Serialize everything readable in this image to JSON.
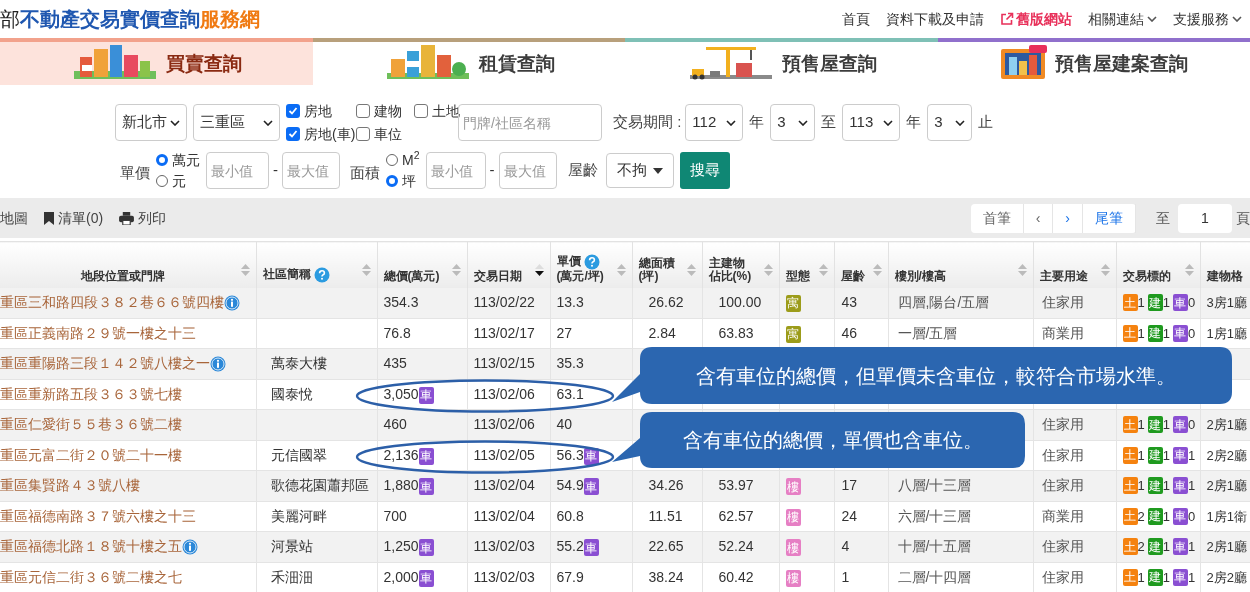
{
  "header": {
    "logo_prefix": "部",
    "logo_main": "不動產交易實價查詢",
    "logo_accent": "服務網",
    "nav": [
      {
        "label": "首頁",
        "kind": "link"
      },
      {
        "label": "資料下載及申請",
        "kind": "link"
      },
      {
        "label": "舊版網站",
        "kind": "external"
      },
      {
        "label": "相關連結",
        "kind": "menu"
      },
      {
        "label": "支援服務",
        "kind": "menu"
      }
    ]
  },
  "tabs": [
    {
      "label": "買賣查詢",
      "selected": true,
      "color": "#f2a28c"
    },
    {
      "label": "租賃查詢",
      "selected": false,
      "color": "#b8a07c"
    },
    {
      "label": "預售屋查詢",
      "selected": false,
      "color": "#7fc0b6"
    },
    {
      "label": "預售屋建案查詢",
      "selected": false,
      "color": "#9070cc"
    }
  ],
  "filters": {
    "city": "新北市",
    "district": "三重區",
    "checkboxes": [
      {
        "label": "房地",
        "checked": true
      },
      {
        "label": "房地(車)",
        "checked": true
      },
      {
        "label": "建物",
        "checked": false
      },
      {
        "label": "車位",
        "checked": false
      },
      {
        "label": "土地",
        "checked": false
      }
    ],
    "address_placeholder": "門牌/社區名稱",
    "period": {
      "label": "交易期間 :",
      "from_year": "112",
      "from_year_unit": "年",
      "from_month": "3",
      "to": "至",
      "to_year": "113",
      "to_year_unit": "年",
      "to_month": "3",
      "end": "止"
    },
    "price": {
      "label": "單價",
      "options": [
        {
          "label": "萬元",
          "selected": true
        },
        {
          "label": "元",
          "selected": false
        }
      ],
      "min_placeholder": "最小值",
      "dash": "-",
      "max_placeholder": "最大值"
    },
    "area": {
      "label": "面積",
      "options": [
        {
          "label": "M$^{2}$",
          "selected": false
        },
        {
          "label": "坪",
          "selected": true
        }
      ],
      "min_placeholder": "最小值",
      "dash": "-",
      "max_placeholder": "最大值"
    },
    "age": {
      "label": "屋齡",
      "value": "不拘"
    },
    "search_button": "搜尋"
  },
  "toolbar": {
    "items": [
      {
        "label": "地圖",
        "kind": "map"
      },
      {
        "label": "清單(0)",
        "kind": "list"
      },
      {
        "label": "列印",
        "kind": "print"
      }
    ],
    "pager": [
      {
        "label": "首筆",
        "disabled": true
      },
      {
        "label": "‹",
        "disabled": true
      },
      {
        "label": "›",
        "disabled": false
      },
      {
        "label": "尾筆",
        "disabled": false
      }
    ],
    "goto": "至",
    "page": "1",
    "page_unit": "頁"
  },
  "table": {
    "columns": [
      {
        "label": "地段位置或門牌",
        "help": false,
        "sortable": true,
        "sorted": false
      },
      {
        "label": "社區簡稱",
        "help": true,
        "sortable": true,
        "sorted": false
      },
      {
        "label": "總價(萬元)",
        "help": false,
        "sortable": true,
        "sorted": false
      },
      {
        "label": "交易日期",
        "help": false,
        "sortable": true,
        "sorted": true
      },
      {
        "label": "單價",
        "sub": "(萬元/坪)",
        "help": true,
        "sortable": true,
        "sorted": false
      },
      {
        "label": "總面積",
        "sub": "(坪)",
        "help": false,
        "sortable": true,
        "sorted": false
      },
      {
        "label": "主建物",
        "sub": "佔比(%)",
        "help": false,
        "sortable": true,
        "sorted": false
      },
      {
        "label": "型態",
        "help": false,
        "sortable": true,
        "sorted": false
      },
      {
        "label": "屋齡",
        "help": false,
        "sortable": true,
        "sorted": false
      },
      {
        "label": "樓別/樓高",
        "help": false,
        "sortable": true,
        "sorted": false
      },
      {
        "label": "主要用途",
        "help": false,
        "sortable": true,
        "sorted": false
      },
      {
        "label": "交易標的",
        "help": false,
        "sortable": true,
        "sorted": false
      },
      {
        "label": "建物格",
        "help": false,
        "sortable": false
      }
    ],
    "rows": [
      {
        "address": "重區三和路四段３８２巷６６號四樓",
        "info": true,
        "total": "354.3",
        "date": "113/02/22",
        "unit": "13.3",
        "area": "26.62",
        "ratio": "100.00",
        "type": {
          "label": "寓",
          "color": "#9c9c1a"
        },
        "age": "43",
        "floor": "四層,陽台/五層",
        "use": "住家用",
        "targets": [
          {
            "label": "土",
            "count": "1",
            "color": "#f5820f"
          },
          {
            "label": "建",
            "count": "1",
            "color": "#1f9a1f"
          },
          {
            "label": "車",
            "count": "0",
            "color": "#8a4fd2"
          }
        ],
        "layout": "3房1廳"
      },
      {
        "address": "重區正義南路２９號一樓之十三",
        "info": false,
        "total": "76.8",
        "date": "113/02/17",
        "unit": "27",
        "area": "2.84",
        "ratio": "63.83",
        "type": {
          "label": "寓",
          "color": "#9c9c1a"
        },
        "age": "46",
        "floor": "一層/五層",
        "use": "商業用",
        "targets": [
          {
            "label": "土",
            "count": "1",
            "color": "#f5820f"
          },
          {
            "label": "建",
            "count": "1",
            "color": "#1f9a1f"
          },
          {
            "label": "車",
            "count": "0",
            "color": "#8a4fd2"
          }
        ],
        "layout": "1房1廳"
      },
      {
        "address": "重區重陽路三段１４２號八樓之一",
        "info": true,
        "community": "萬泰大樓",
        "total": "435",
        "date": "113/02/15",
        "unit": "35.3"
      },
      {
        "address": "重區重新路五段３６３號七樓",
        "info": false,
        "community": "國泰悅",
        "total": "3,050",
        "total_badge": "車",
        "date": "113/02/06",
        "unit": "63.1"
      },
      {
        "address": "重區仁愛街５５巷３６號二樓",
        "info": false,
        "total": "460",
        "date": "113/02/06",
        "unit": "40",
        "use": "住家用",
        "targets": [
          {
            "label": "土",
            "count": "1",
            "color": "#f5820f"
          },
          {
            "label": "建",
            "count": "1",
            "color": "#1f9a1f"
          },
          {
            "label": "車",
            "count": "0",
            "color": "#8a4fd2"
          }
        ],
        "layout": "2房1廳"
      },
      {
        "address": "重區元富二街２０號二十一樓",
        "info": false,
        "community": "元信國翠",
        "total": "2,136",
        "total_badge": "車",
        "date": "113/02/05",
        "unit": "56.3",
        "unit_badge": "車",
        "use": "住家用",
        "targets": [
          {
            "label": "土",
            "count": "1",
            "color": "#f5820f"
          },
          {
            "label": "建",
            "count": "1",
            "color": "#1f9a1f"
          },
          {
            "label": "車",
            "count": "1",
            "color": "#8a4fd2"
          }
        ],
        "layout": "2房2廳"
      },
      {
        "address": "重區集賢路４３號八樓",
        "info": false,
        "community": "歌德花園蕭邦區",
        "total": "1,880",
        "total_badge": "車",
        "date": "113/02/04",
        "unit": "54.9",
        "unit_badge": "車",
        "area": "34.26",
        "ratio": "53.97",
        "type": {
          "label": "樓",
          "color": "#e67fc4"
        },
        "age": "17",
        "floor": "八層/十三層",
        "use": "住家用",
        "targets": [
          {
            "label": "土",
            "count": "1",
            "color": "#f5820f"
          },
          {
            "label": "建",
            "count": "1",
            "color": "#1f9a1f"
          },
          {
            "label": "車",
            "count": "1",
            "color": "#8a4fd2"
          }
        ],
        "layout": "2房1廳"
      },
      {
        "address": "重區福德南路３７號六樓之十三",
        "info": false,
        "community": "美麗河畔",
        "total": "700",
        "date": "113/02/04",
        "unit": "60.8",
        "area": "11.51",
        "ratio": "62.57",
        "type": {
          "label": "樓",
          "color": "#e67fc4"
        },
        "age": "24",
        "floor": "六層/十三層",
        "use": "商業用",
        "targets": [
          {
            "label": "土",
            "count": "2",
            "color": "#f5820f"
          },
          {
            "label": "建",
            "count": "1",
            "color": "#1f9a1f"
          },
          {
            "label": "車",
            "count": "0",
            "color": "#8a4fd2"
          }
        ],
        "layout": "1房1衛"
      },
      {
        "address": "重區福德北路１８號十樓之五",
        "info": true,
        "community": "河景站",
        "total": "1,250",
        "total_badge": "車",
        "date": "113/02/03",
        "unit": "55.2",
        "unit_badge": "車",
        "area": "22.65",
        "ratio": "52.24",
        "type": {
          "label": "樓",
          "color": "#e67fc4"
        },
        "age": "4",
        "floor": "十層/十五層",
        "use": "住家用",
        "targets": [
          {
            "label": "土",
            "count": "2",
            "color": "#f5820f"
          },
          {
            "label": "建",
            "count": "1",
            "color": "#1f9a1f"
          },
          {
            "label": "車",
            "count": "1",
            "color": "#8a4fd2"
          }
        ],
        "layout": "2房1廳"
      },
      {
        "address": "重區元信二街３６號二樓之七",
        "info": false,
        "community": "禾沺沺",
        "total": "2,000",
        "total_badge": "車",
        "date": "113/02/03",
        "unit": "67.9",
        "area": "38.24",
        "ratio": "60.42",
        "type": {
          "label": "樓",
          "color": "#e67fc4"
        },
        "age": "1",
        "floor": "二層/十四層",
        "use": "住家用",
        "targets": [
          {
            "label": "土",
            "count": "1",
            "color": "#f5820f"
          },
          {
            "label": "建",
            "count": "1",
            "color": "#1f9a1f"
          },
          {
            "label": "車",
            "count": "1",
            "color": "#8a4fd2"
          }
        ],
        "layout": "2房2廳"
      }
    ]
  },
  "annotations": [
    {
      "text": "含有車位的總價，但單價未含車位，較符合市場水準。"
    },
    {
      "text": "含有車位的總價，單價也含車位。"
    }
  ]
}
